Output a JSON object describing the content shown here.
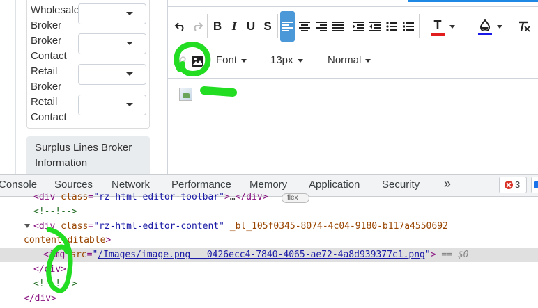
{
  "form": {
    "labels": [
      {
        "line1": "Wholesale",
        "line2": "Broker"
      },
      {
        "line1": "Broker",
        "line2": "Contact"
      },
      {
        "line1": "Retail",
        "line2": "Broker"
      },
      {
        "line1": "Retail",
        "line2": "Contact"
      }
    ],
    "surplus_section": {
      "line1": "Surplus Lines Broker",
      "line2": "Information"
    }
  },
  "editor": {
    "toolbar": {
      "font_label": "Font",
      "size_label": "13px",
      "format_label": "Normal",
      "font_color": "#e11d1d",
      "background_color": "#1a1ae8",
      "active_color": "#4a98d8"
    }
  },
  "devtools": {
    "tabs": [
      "Console",
      "Sources",
      "Network",
      "Performance",
      "Memory",
      "Application",
      "Security"
    ],
    "more": "»",
    "error_count": "3",
    "elements": {
      "line0_class": "rz-html-editor-toolbar",
      "flex_badge": "flex",
      "comment": "<!--!-->",
      "content_class": "rz-html-editor-content",
      "content_attr": "_bl_105f0345-8074-4c04-9180-b117a4550692",
      "contenteditable": "contenteditable",
      "img_src": "/Images/image.png___0426ecc4-7840-4065-ae72-4a8d939377c1.png",
      "selected_marker": "== $0"
    }
  },
  "colors": {
    "annotation": "#22dd22",
    "devtools_bg": "#f1f3f4",
    "selection": "#e0e0e0"
  }
}
